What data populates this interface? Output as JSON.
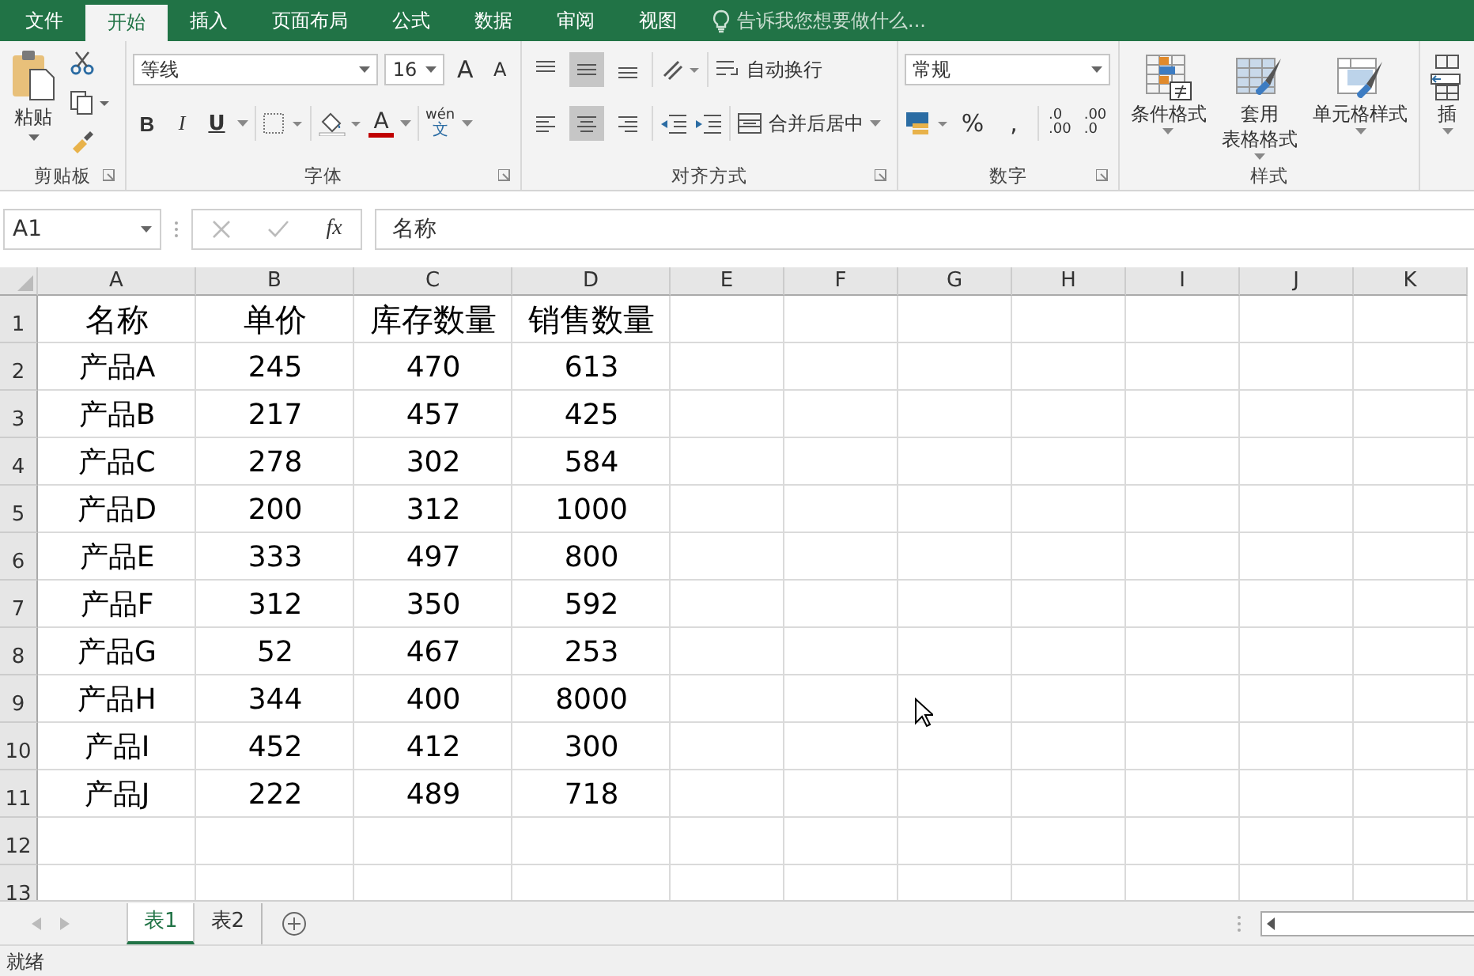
{
  "tabs": [
    {
      "label": "文件",
      "selected": false
    },
    {
      "label": "开始",
      "selected": true
    },
    {
      "label": "插入",
      "selected": false
    },
    {
      "label": "页面布局",
      "selected": false
    },
    {
      "label": "公式",
      "selected": false
    },
    {
      "label": "数据",
      "selected": false
    },
    {
      "label": "审阅",
      "selected": false
    },
    {
      "label": "视图",
      "selected": false
    }
  ],
  "search": {
    "placeholder": "告诉我您想要做什么..."
  },
  "ribbon": {
    "clipboard": {
      "paste": "粘贴",
      "label": "剪贴板"
    },
    "font": {
      "name": "等线",
      "size": "16",
      "grow": "A",
      "shrink": "A",
      "bold": "B",
      "italic": "I",
      "underline": "U",
      "color_letter": "A",
      "phonetic_top": "wén",
      "phonetic_bottom": "文",
      "label": "字体"
    },
    "alignment": {
      "vertical_align": [
        {
          "selected": false
        },
        {
          "selected": true
        },
        {
          "selected": false
        }
      ],
      "horizontal_align": [
        {
          "selected": false
        },
        {
          "selected": true
        },
        {
          "selected": false
        }
      ],
      "wrap": "自动换行",
      "merge": "合并后居中",
      "label": "对齐方式"
    },
    "number": {
      "format": "常规",
      "percent": "%",
      "comma": ",",
      "increase_decimal": {
        "top": ".0",
        "bottom": ".00"
      },
      "decrease_decimal": {
        "top": ".00",
        "bottom": ".0"
      },
      "label": "数字"
    },
    "styles": {
      "buttons": [
        {
          "lines": [
            "条件格式"
          ]
        },
        {
          "lines": [
            "套用",
            "表格格式"
          ]
        },
        {
          "lines": [
            "单元格样式"
          ]
        }
      ],
      "label": "样式"
    },
    "cells": {
      "buttons": [
        {
          "lines": [
            "插"
          ]
        }
      ]
    }
  },
  "formula_bar": {
    "name_box": "A1",
    "function_label": "fx",
    "value": "名称"
  },
  "sheet": {
    "columns": [
      "A",
      "B",
      "C",
      "D",
      "E",
      "F",
      "G",
      "H",
      "I",
      "J",
      "K"
    ],
    "rows": [
      {
        "number": "1",
        "cells": [
          "名称",
          "单价",
          "库存数量",
          "销售数量"
        ]
      },
      {
        "number": "2",
        "cells": [
          "产品A",
          "245",
          "470",
          "613"
        ]
      },
      {
        "number": "3",
        "cells": [
          "产品B",
          "217",
          "457",
          "425"
        ]
      },
      {
        "number": "4",
        "cells": [
          "产品C",
          "278",
          "302",
          "584"
        ]
      },
      {
        "number": "5",
        "cells": [
          "产品D",
          "200",
          "312",
          "1000"
        ]
      },
      {
        "number": "6",
        "cells": [
          "产品E",
          "333",
          "497",
          "800"
        ]
      },
      {
        "number": "7",
        "cells": [
          "产品F",
          "312",
          "350",
          "592"
        ]
      },
      {
        "number": "8",
        "cells": [
          "产品G",
          "52",
          "467",
          "253"
        ]
      },
      {
        "number": "9",
        "cells": [
          "产品H",
          "344",
          "400",
          "8000"
        ]
      },
      {
        "number": "10",
        "cells": [
          "产品I",
          "452",
          "412",
          "300"
        ]
      },
      {
        "number": "11",
        "cells": [
          "产品J",
          "222",
          "489",
          "718"
        ]
      },
      {
        "number": "12",
        "cells": []
      },
      {
        "number": "13",
        "cells": []
      }
    ]
  },
  "sheet_tabs": [
    {
      "label": "表1",
      "selected": true
    },
    {
      "label": "表2",
      "selected": false
    }
  ],
  "status_bar": {
    "text": "就绪"
  }
}
